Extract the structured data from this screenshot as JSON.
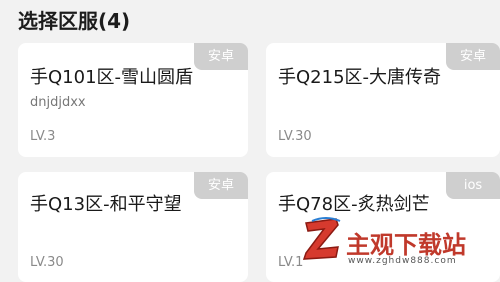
{
  "header": {
    "title": "选择区服(4)"
  },
  "servers": [
    {
      "name": "手Q101区-雪山圆盾",
      "role": "dnjdjdxx",
      "level": "LV.3",
      "platform": "安卓"
    },
    {
      "name": "手Q215区-大唐传奇",
      "role": "",
      "level": "LV.30",
      "platform": "安卓"
    },
    {
      "name": "手Q13区-和平守望",
      "role": "",
      "level": "LV.30",
      "platform": "安卓"
    },
    {
      "name": "手Q78区-炙热剑芒",
      "role": "",
      "level": "LV.1",
      "platform": "ios"
    }
  ],
  "watermark": {
    "brand": "主观下载站",
    "url": "www.zghdw888.com"
  },
  "colors": {
    "background": "#f2f2f2",
    "card": "#ffffff",
    "badge": "#cfcfcf",
    "watermark_red": "#c0392b"
  }
}
